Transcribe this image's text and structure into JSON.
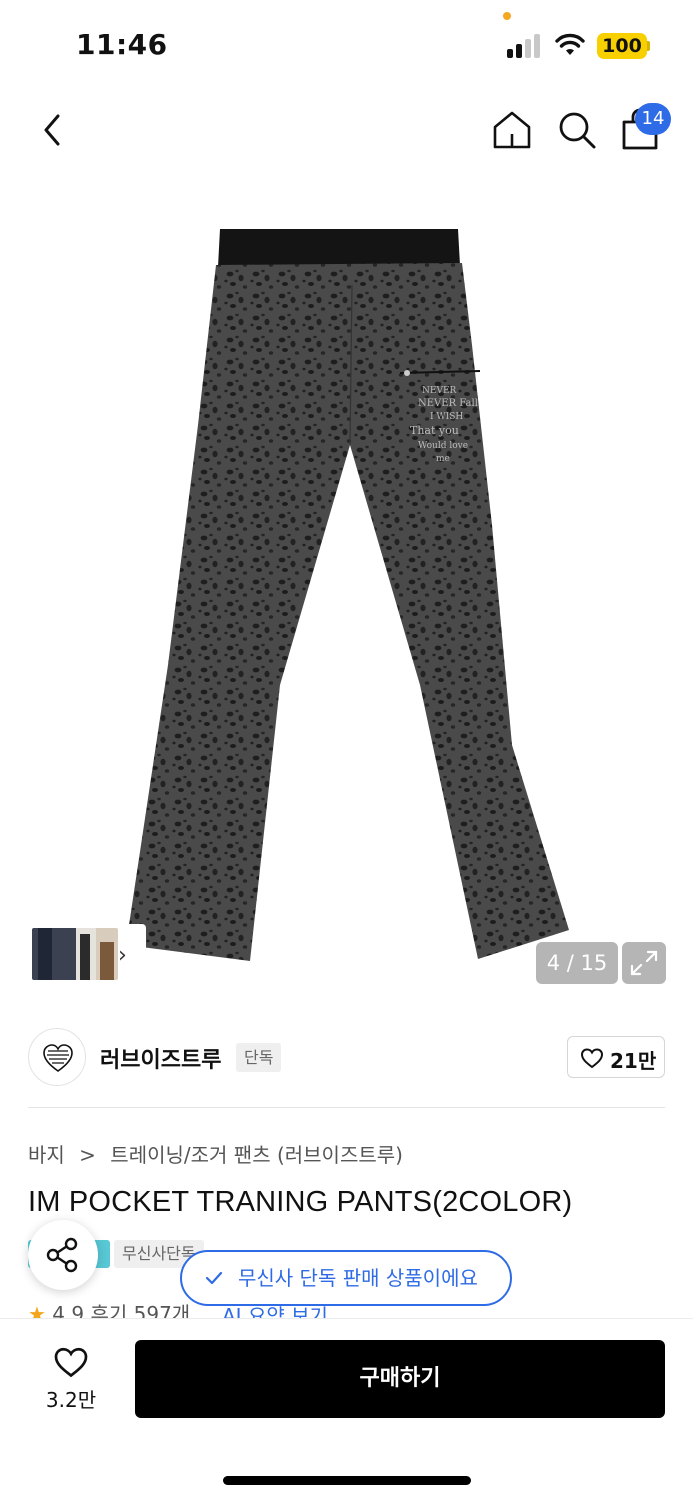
{
  "status": {
    "time": "11:46",
    "battery": "100"
  },
  "nav": {
    "cart_count": "14"
  },
  "gallery": {
    "counter": "4 / 15"
  },
  "brand": {
    "name": "러브이즈트루",
    "tag": "단독",
    "likes": "21만"
  },
  "breadcrumb": {
    "level1": "바지",
    "separator": ">",
    "level2": "트레이닝/조거 팬츠 (러브이즈트루)"
  },
  "product": {
    "title": "IM POCKET TRANING PANTS(2COLOR)",
    "tag2": "무신사단독"
  },
  "rating": {
    "score": "4.9",
    "reviews": "후기 597개",
    "ai_summary": "AI 요약 보기"
  },
  "toast": {
    "text": "무신사 단독 판매 상품이에요"
  },
  "bottom": {
    "like_count": "3.2만",
    "buy_label": "구매하기"
  },
  "colors": {
    "accent": "#2e6be6",
    "badge_yellow": "#f8d000",
    "star": "#f3a51c",
    "tag_teal": "#58c8d5"
  },
  "icons": [
    "back-icon",
    "home-icon",
    "search-icon",
    "cart-icon",
    "chevron-right-icon",
    "expand-icon",
    "heart-icon",
    "share-icon",
    "check-icon",
    "star-icon"
  ]
}
